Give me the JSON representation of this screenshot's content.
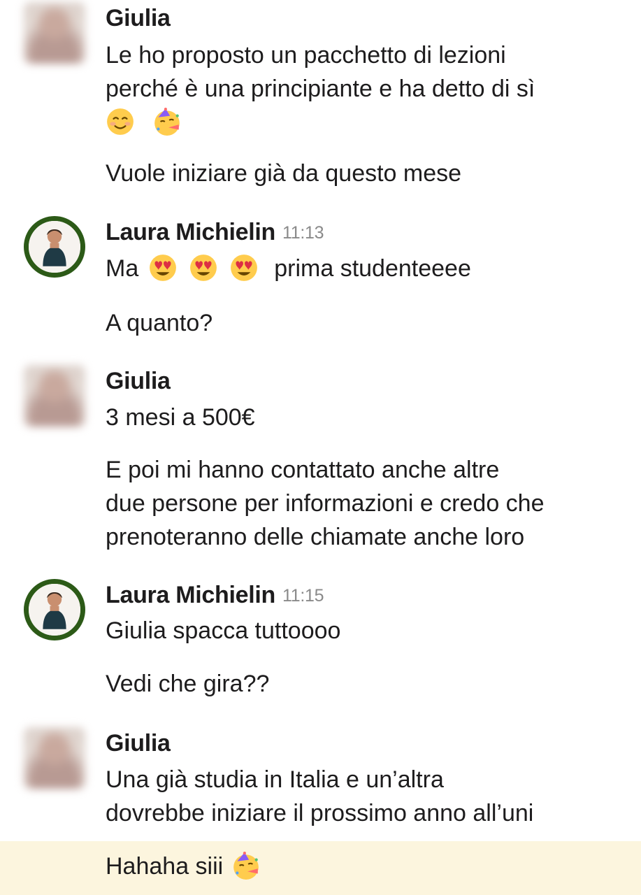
{
  "messages": [
    {
      "author": "Giulia",
      "time": "",
      "lines": [
        "Le ho proposto un pacchetto di lezioni",
        "perché è una principiante e ha detto di sì",
        "Vuole iniziare già da questo mese"
      ],
      "emojis": [
        "smiling-face-icon",
        "party-face-icon"
      ]
    },
    {
      "author": "Laura Michielin",
      "time": "11:13",
      "lines": [
        "Ma",
        "prima studenteeee",
        "A quanto?"
      ],
      "emojis": [
        "heart-eyes-icon",
        "heart-eyes-icon",
        "heart-eyes-icon"
      ]
    },
    {
      "author": "Giulia",
      "time": "",
      "lines": [
        "3 mesi a 500€",
        "E poi mi hanno contattato anche altre",
        "due persone per informazioni e credo che",
        "prenoteranno delle chiamate anche loro"
      ]
    },
    {
      "author": "Laura Michielin",
      "time": "11:15",
      "lines": [
        "Giulia spacca tuttoooo",
        "Vedi che gira??"
      ]
    },
    {
      "author": "Giulia",
      "time": "",
      "lines": [
        "Una già studia in Italia e un’altra",
        "dovrebbe iniziare il prossimo anno all’uni",
        "Hahaha siii"
      ],
      "emojis": [
        "party-face-icon"
      ]
    }
  ],
  "colors": {
    "highlight": "#fcf5de",
    "avatar_ring": "#2c5a17",
    "timestamp": "#8a8a8a"
  }
}
